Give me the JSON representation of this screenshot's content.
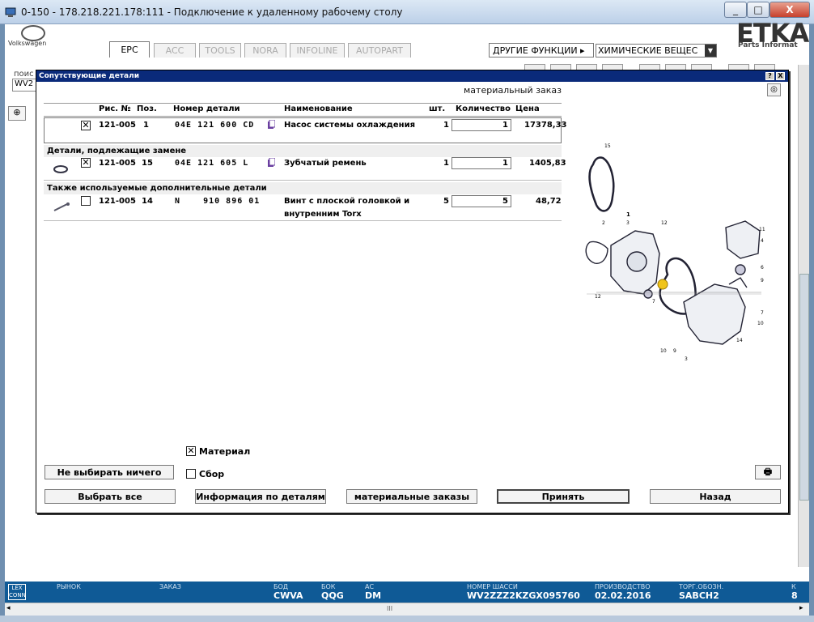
{
  "window": {
    "title": "0-150 - 178.218.221.178:111 - Подключение к удаленному рабочему столу",
    "close_label": "X",
    "minimize_label": "_",
    "maximize_label": "□"
  },
  "app": {
    "brand": "Volkswagen",
    "logo_text": "ETKA",
    "logo_sub": "Parts Informat",
    "tabs": [
      {
        "label": "EPC",
        "active": true
      },
      {
        "label": "ACC",
        "active": false
      },
      {
        "label": "TOOLS",
        "active": false
      },
      {
        "label": "NORA",
        "active": false
      },
      {
        "label": "INFOLINE",
        "active": false
      },
      {
        "label": "AUTOPART",
        "active": false
      }
    ],
    "other_functions": "ДРУГИЕ ФУНКЦИИ ▸",
    "chem_select": "ХИМИЧЕСКИЕ ВЕЩЕС",
    "search_label": "поис",
    "search_value": "WV2"
  },
  "dialog": {
    "title": "Сопутствующие детали",
    "subtitle": "материальный заказ",
    "help_label": "?",
    "close_label": "X",
    "columns": {
      "fig_no": "Рис. №",
      "pos": "Поз.",
      "part_no": "Номер детали",
      "name": "Наименование",
      "pcs": "шт.",
      "quantity": "Количество",
      "price": "Цена"
    },
    "main_row": {
      "checked": true,
      "fig": "121-005",
      "pos": "1",
      "part": "04E 121 600 CD",
      "name": "Насос системы охлаждения",
      "pcs": "1",
      "qty": "1",
      "price": "17378,33"
    },
    "section1": {
      "title": "Детали, подлежащие замене",
      "row": {
        "checked": true,
        "fig": "121-005",
        "pos": "15",
        "part": "04E 121 605 L",
        "name": "Зубчатый ремень",
        "pcs": "1",
        "qty": "1",
        "price": "1405,83"
      }
    },
    "section2": {
      "title": "Также используемые дополнительные детали",
      "row": {
        "checked": false,
        "fig": "121-005",
        "pos": "14",
        "part": "N    910 896 01",
        "name1": "Винт с плоской головкой и",
        "name2": "внутренним Torx",
        "pcs": "5",
        "qty": "5",
        "price": "48,72"
      }
    },
    "diagram_labels": {
      "l15": "15",
      "l2": "2",
      "l3": "3",
      "l1": "1",
      "l12": "12",
      "l11": "11",
      "l4": "4",
      "l6": "6",
      "l9": "9",
      "l7": "7",
      "l10": "10",
      "l14": "14",
      "l10b": "10",
      "l9b": "9",
      "l3b": "3",
      "l12b": "12",
      "l7b": "7"
    },
    "material_checkbox": {
      "label": "Материал",
      "checked": true
    },
    "sbor_checkbox": {
      "label": "Сбор",
      "checked": false
    },
    "buttons": {
      "select_none": "Не выбирать ничего",
      "select_all": "Выбрать все",
      "parts_info": "Информация по деталям",
      "material_orders": "материальные заказы",
      "accept": "Принять",
      "back": "Назад"
    }
  },
  "statusbar": {
    "lexcon": "LEX CONN",
    "market_label": "РЫНОК",
    "order_label": "ЗАКАЗ",
    "bod_label": "БОД",
    "bod_value": "CWVA",
    "box_label": "БОК",
    "box_value": "QQG",
    "ac_label": "АС",
    "ac_value": "DM",
    "vin_label": "НОМЕР ШАССИ",
    "vin_value": "WV2ZZZ2KZGX095760",
    "prod_label": "ПРОИЗВОДСТВО",
    "prod_value": "02.02.2016",
    "trade_label": "ТОРГ.ОБОЗН.",
    "trade_value": "SABCH2",
    "k_label": "К",
    "k_value": "8"
  },
  "hscroll": {
    "grip": "III"
  }
}
